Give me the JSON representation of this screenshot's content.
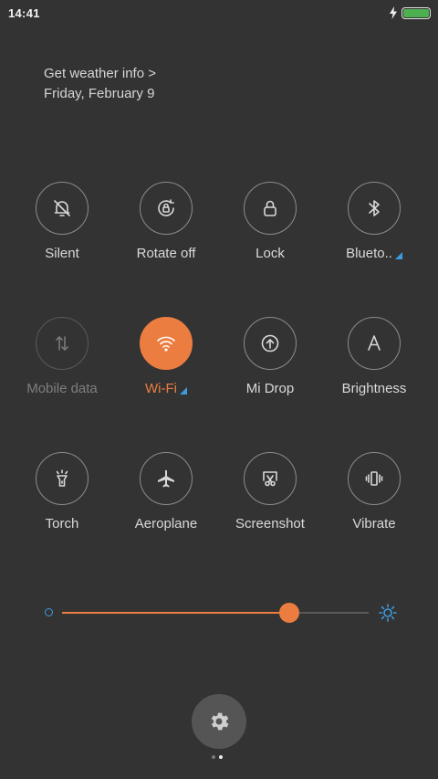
{
  "status_bar": {
    "time": "14:41",
    "battery_level": 1.0,
    "charging": true,
    "battery_color": "#4caf50"
  },
  "info": {
    "weather_link": "Get weather info >",
    "date": "Friday, February 9"
  },
  "toggles": [
    [
      {
        "label": "Silent",
        "icon": "bell-off-icon",
        "state": "off",
        "has_more": false
      },
      {
        "label": "Rotate off",
        "icon": "rotate-lock-icon",
        "state": "off",
        "has_more": false
      },
      {
        "label": "Lock",
        "icon": "padlock-icon",
        "state": "off",
        "has_more": false
      },
      {
        "label": "Blueto..",
        "icon": "bluetooth-icon",
        "state": "off",
        "has_more": true
      }
    ],
    [
      {
        "label": "Mobile data",
        "icon": "mobile-data-icon",
        "state": "disabled",
        "has_more": false
      },
      {
        "label": "Wi-Fi",
        "icon": "wifi-icon",
        "state": "on",
        "has_more": true
      },
      {
        "label": "Mi Drop",
        "icon": "mi-drop-icon",
        "state": "off",
        "has_more": false
      },
      {
        "label": "Brightness",
        "icon": "auto-brightness-icon",
        "state": "off",
        "has_more": false
      }
    ],
    [
      {
        "label": "Torch",
        "icon": "flashlight-icon",
        "state": "off",
        "has_more": false
      },
      {
        "label": "Aeroplane",
        "icon": "airplane-icon",
        "state": "off",
        "has_more": false
      },
      {
        "label": "Screenshot",
        "icon": "scissors-icon",
        "state": "off",
        "has_more": false
      },
      {
        "label": "Vibrate",
        "icon": "vibrate-icon",
        "state": "off",
        "has_more": false
      }
    ]
  ],
  "brightness": {
    "level": 0.74,
    "min_icon": "dim-sun-icon",
    "max_icon": "bright-sun-icon"
  },
  "settings": {
    "icon": "gear-icon"
  },
  "pager": {
    "pages": 2,
    "current": 2
  },
  "colors": {
    "accent": "#ec7d41",
    "background": "#333333",
    "secondary_accent": "#3d9be0"
  }
}
